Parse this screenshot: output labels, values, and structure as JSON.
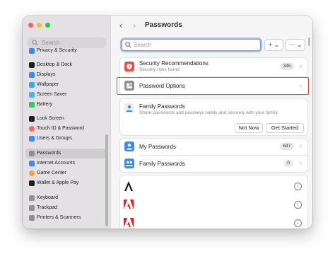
{
  "sidebar": {
    "search_placeholder": "Search",
    "items": [
      {
        "label": "Privacy & Security",
        "icon": "hand-icon",
        "color": "#3d8af7"
      },
      {
        "label": "Desktop & Dock",
        "icon": "dock-icon",
        "color": "#1d1d1f"
      },
      {
        "label": "Displays",
        "icon": "display-icon",
        "color": "#3d8af7"
      },
      {
        "label": "Wallpaper",
        "icon": "wallpaper-icon",
        "color": "#38a8f0"
      },
      {
        "label": "Screen Saver",
        "icon": "screensaver-icon",
        "color": "#46b4e8"
      },
      {
        "label": "Battery",
        "icon": "battery-icon",
        "color": "#34c759"
      },
      {
        "label": "Lock Screen",
        "icon": "lock-icon",
        "color": "#1d1d1f"
      },
      {
        "label": "Touch ID & Password",
        "icon": "fingerprint-icon",
        "color": "#ff6a5b"
      },
      {
        "label": "Users & Groups",
        "icon": "users-icon",
        "color": "#3d8af7"
      },
      {
        "label": "Passwords",
        "icon": "key-icon",
        "color": "#8e8e93",
        "selected": true
      },
      {
        "label": "Internet Accounts",
        "icon": "at-icon",
        "color": "#3d8af7"
      },
      {
        "label": "Game Center",
        "icon": "game-center-icon",
        "color": "#f2a33a"
      },
      {
        "label": "Wallet & Apple Pay",
        "icon": "wallet-icon",
        "color": "#1d1d1f"
      },
      {
        "label": "Keyboard",
        "icon": "keyboard-icon",
        "color": "#8e8e93"
      },
      {
        "label": "Trackpad",
        "icon": "trackpad-icon",
        "color": "#8e8e93"
      },
      {
        "label": "Printers & Scanners",
        "icon": "printer-icon",
        "color": "#8e8e93"
      }
    ]
  },
  "toolbar": {
    "back": "‹",
    "forward": "›",
    "title": "Passwords",
    "search_placeholder": "Search",
    "add_label": "+ ⌄",
    "more_label": "··· ⌄"
  },
  "security": {
    "title": "Security Recommendations",
    "subtitle": "Security risks found",
    "count": "345",
    "color": "#e8514a"
  },
  "options": {
    "title": "Password Options",
    "color": "#8e8e93"
  },
  "family": {
    "title": "Family Passwords",
    "subtitle": "Share passwords and passkeys safely and securely with your family.",
    "not_now": "Not Now",
    "get_started": "Get Started"
  },
  "accounts": {
    "my_title": "My Passwords",
    "my_count": "647",
    "family_title": "Family Passwords",
    "family_count": "0",
    "color": "#3d8af7"
  },
  "list_items": [
    {
      "icon": "a-logo-icon"
    },
    {
      "icon": "adobe-logo-icon"
    },
    {
      "icon": "adobe-logo-icon"
    }
  ],
  "chevron": "›",
  "info_glyph": "i"
}
